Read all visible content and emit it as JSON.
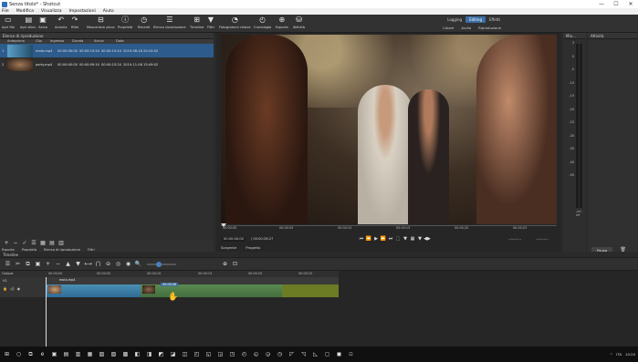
{
  "window": {
    "title": "Senza titolo* - Shotcut",
    "minimize": "—",
    "maximize": "☐",
    "close": "✕"
  },
  "menu": [
    "File",
    "Modifica",
    "Visualizza",
    "Impostazioni",
    "Aiuto"
  ],
  "toolbar": {
    "items": [
      {
        "label": "Apri file",
        "icon": "folder-icon"
      },
      {
        "label": "Apri altro..",
        "icon": "open-other-icon"
      },
      {
        "label": "Salva",
        "icon": "save-icon"
      },
      {
        "label": "Annulla",
        "icon": "undo-icon"
      },
      {
        "label": "Rifai",
        "icon": "redo-icon"
      },
      {
        "label": "Mascartore picco",
        "icon": "peak-meter-icon"
      },
      {
        "label": "Proprietà",
        "icon": "properties-icon"
      },
      {
        "label": "Recenti",
        "icon": "recent-icon"
      },
      {
        "label": "Elenco riproduzione",
        "icon": "playlist-icon"
      },
      {
        "label": "Timeline",
        "icon": "timeline-icon"
      },
      {
        "label": "Filtri",
        "icon": "filter-icon"
      },
      {
        "label": "Fotogrammi chiave",
        "icon": "keyframes-icon"
      },
      {
        "label": "Cronologia",
        "icon": "history-icon"
      },
      {
        "label": "Esporta",
        "icon": "export-icon"
      },
      {
        "label": "Attività",
        "icon": "jobs-icon"
      }
    ],
    "layouts": [
      "Logging",
      "Editing",
      "Effetti"
    ],
    "active_layout": "Editing",
    "layout_sub": [
      "Colore",
      "Audio",
      "Riproduzione"
    ]
  },
  "playlist": {
    "title": "Elenco di riproduzione",
    "columns": [
      "",
      "Anteprima",
      "Clip",
      "Ingresso",
      "Durata",
      "Arrivo",
      "Data"
    ],
    "rows": [
      {
        "num": "1",
        "clip": "moto.mp4",
        "in": "00:00:00:00",
        "duration": "00:00:15:24",
        "out": "00:00:15:24",
        "date": "2019-06-16 20:10:52"
      },
      {
        "num": "2",
        "clip": "party.mp4",
        "in": "00:00:00:00",
        "duration": "00:00:09:10",
        "out": "00:00:15:24",
        "date": "2019-11-08 15:49:02"
      }
    ],
    "buttons": [
      "+",
      "−",
      "✓",
      "☰",
      "▦",
      "▤",
      "▥"
    ],
    "tabs": [
      "Esporta",
      "Proprietà",
      "Elenco di riproduzione",
      "Filtri"
    ]
  },
  "viewer": {
    "ruler_ticks": [
      "00:00:00",
      "00:00:05",
      "00:00:10",
      "00:00:15",
      "00:00:20",
      "00:00:25"
    ],
    "timecode": "00:00:00:00",
    "duration": "/ 00:00:28:27",
    "transport": [
      "⏮",
      "⏪",
      "▶",
      "⏩",
      "⏭",
      "⬚",
      "▼",
      "▦",
      "▼",
      "◀▶"
    ],
    "inout_left": "--:--:--:--",
    "inout_right": "--:--:--:--",
    "tabs": [
      "Sorgente",
      "Progetto"
    ]
  },
  "meter": {
    "title": "Mix...",
    "scale": [
      "3",
      "0",
      "-5",
      "-10",
      "-15",
      "-20",
      "-25",
      "-30",
      "-35",
      "-40",
      "-50"
    ],
    "channels": "-inf -inf"
  },
  "activity": {
    "title": "Attività",
    "pause_label": "Pausa"
  },
  "timeline": {
    "title": "Timeline",
    "toolbar": [
      "☰",
      "✂",
      "⧉",
      "▣",
      "+",
      "−",
      "▲",
      "▼",
      "⟷",
      "⋂",
      "⊖",
      "◎",
      "◉",
      "🔍"
    ],
    "ruler": [
      "00:00:00",
      "00:00:05",
      "00:00:10",
      "00:00:15",
      "00:00:20",
      "00:00:25"
    ],
    "output_label": "Output",
    "track_name": "V1",
    "hint": "00:00:06",
    "clips": [
      {
        "title": "moto.mp4"
      },
      {
        "title": ""
      },
      {
        "title": ""
      }
    ]
  },
  "taskbar": {
    "icons": [
      "⊞",
      "○",
      "⧉",
      "e",
      "▣",
      "▤",
      "▥",
      "▦",
      "▧",
      "▨",
      "▩",
      "◧",
      "◨",
      "◩",
      "◪",
      "◫",
      "◰",
      "◱",
      "◲",
      "◳",
      "◴",
      "◵",
      "◶",
      "◷",
      "◸",
      "◹",
      "◺",
      "◻",
      "◼",
      "◽"
    ],
    "tray": [
      "^",
      "ITA",
      "10:20"
    ]
  },
  "colors": {
    "accent": "#2d5b8c",
    "clip_blue": "#2f6b94",
    "clip_green": "#436e3e",
    "clip_olive": "#6b7c25"
  }
}
